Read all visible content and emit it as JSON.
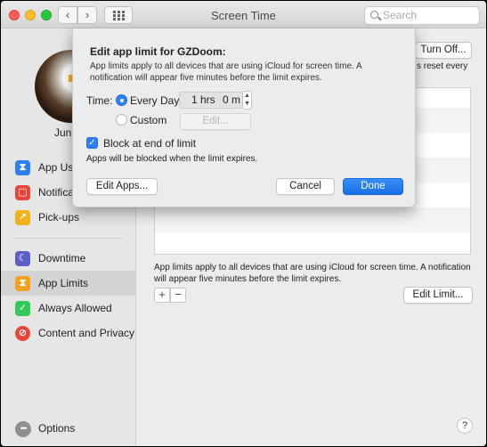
{
  "window": {
    "title": "Screen Time",
    "search_placeholder": "Search"
  },
  "sidebar": {
    "user_name": "Jun",
    "items": [
      {
        "label": "App Us",
        "icon": "hourglass-icon",
        "color": "#2d7ff2"
      },
      {
        "label": "Notifica",
        "icon": "notification-icon",
        "color": "#e8463a"
      },
      {
        "label": "Pick-ups",
        "icon": "pickup-icon",
        "color": "#f2b21c"
      },
      {
        "label": "Downtime",
        "icon": "moon-icon",
        "color": "#5b5fc7"
      },
      {
        "label": "App Limits",
        "icon": "hourglass-icon",
        "color": "#f2a21c"
      },
      {
        "label": "Always Allowed",
        "icon": "checkmark-shield-icon",
        "color": "#34c759"
      },
      {
        "label": "Content and Privacy",
        "icon": "no-entry-icon",
        "color": "#e8463a"
      }
    ],
    "options_label": "Options"
  },
  "main": {
    "turn_off_label": "Turn Off...",
    "reset_every_fragment": "s reset every",
    "footer_text": "App limits apply to all devices that are using iCloud for screen time. A notification will appear five minutes before the limit expires.",
    "edit_limit_label": "Edit Limit...",
    "add_label": "+",
    "remove_label": "−",
    "help_label": "?"
  },
  "dialog": {
    "title": "Edit app limit for GZDoom:",
    "description": "App limits apply to all devices that are using iCloud for screen time. A notification will appear five minutes before the limit expires.",
    "time_label": "Time:",
    "every_day_label": "Every Day",
    "every_day_selected": true,
    "hours_value": "1 hrs",
    "minutes_value": "0 m",
    "custom_label": "Custom",
    "custom_edit_label": "Edit...",
    "block_label": "Block at end of limit",
    "block_checked": true,
    "block_note": "Apps will be blocked when the limit expires.",
    "edit_apps_label": "Edit Apps...",
    "cancel_label": "Cancel",
    "done_label": "Done"
  }
}
